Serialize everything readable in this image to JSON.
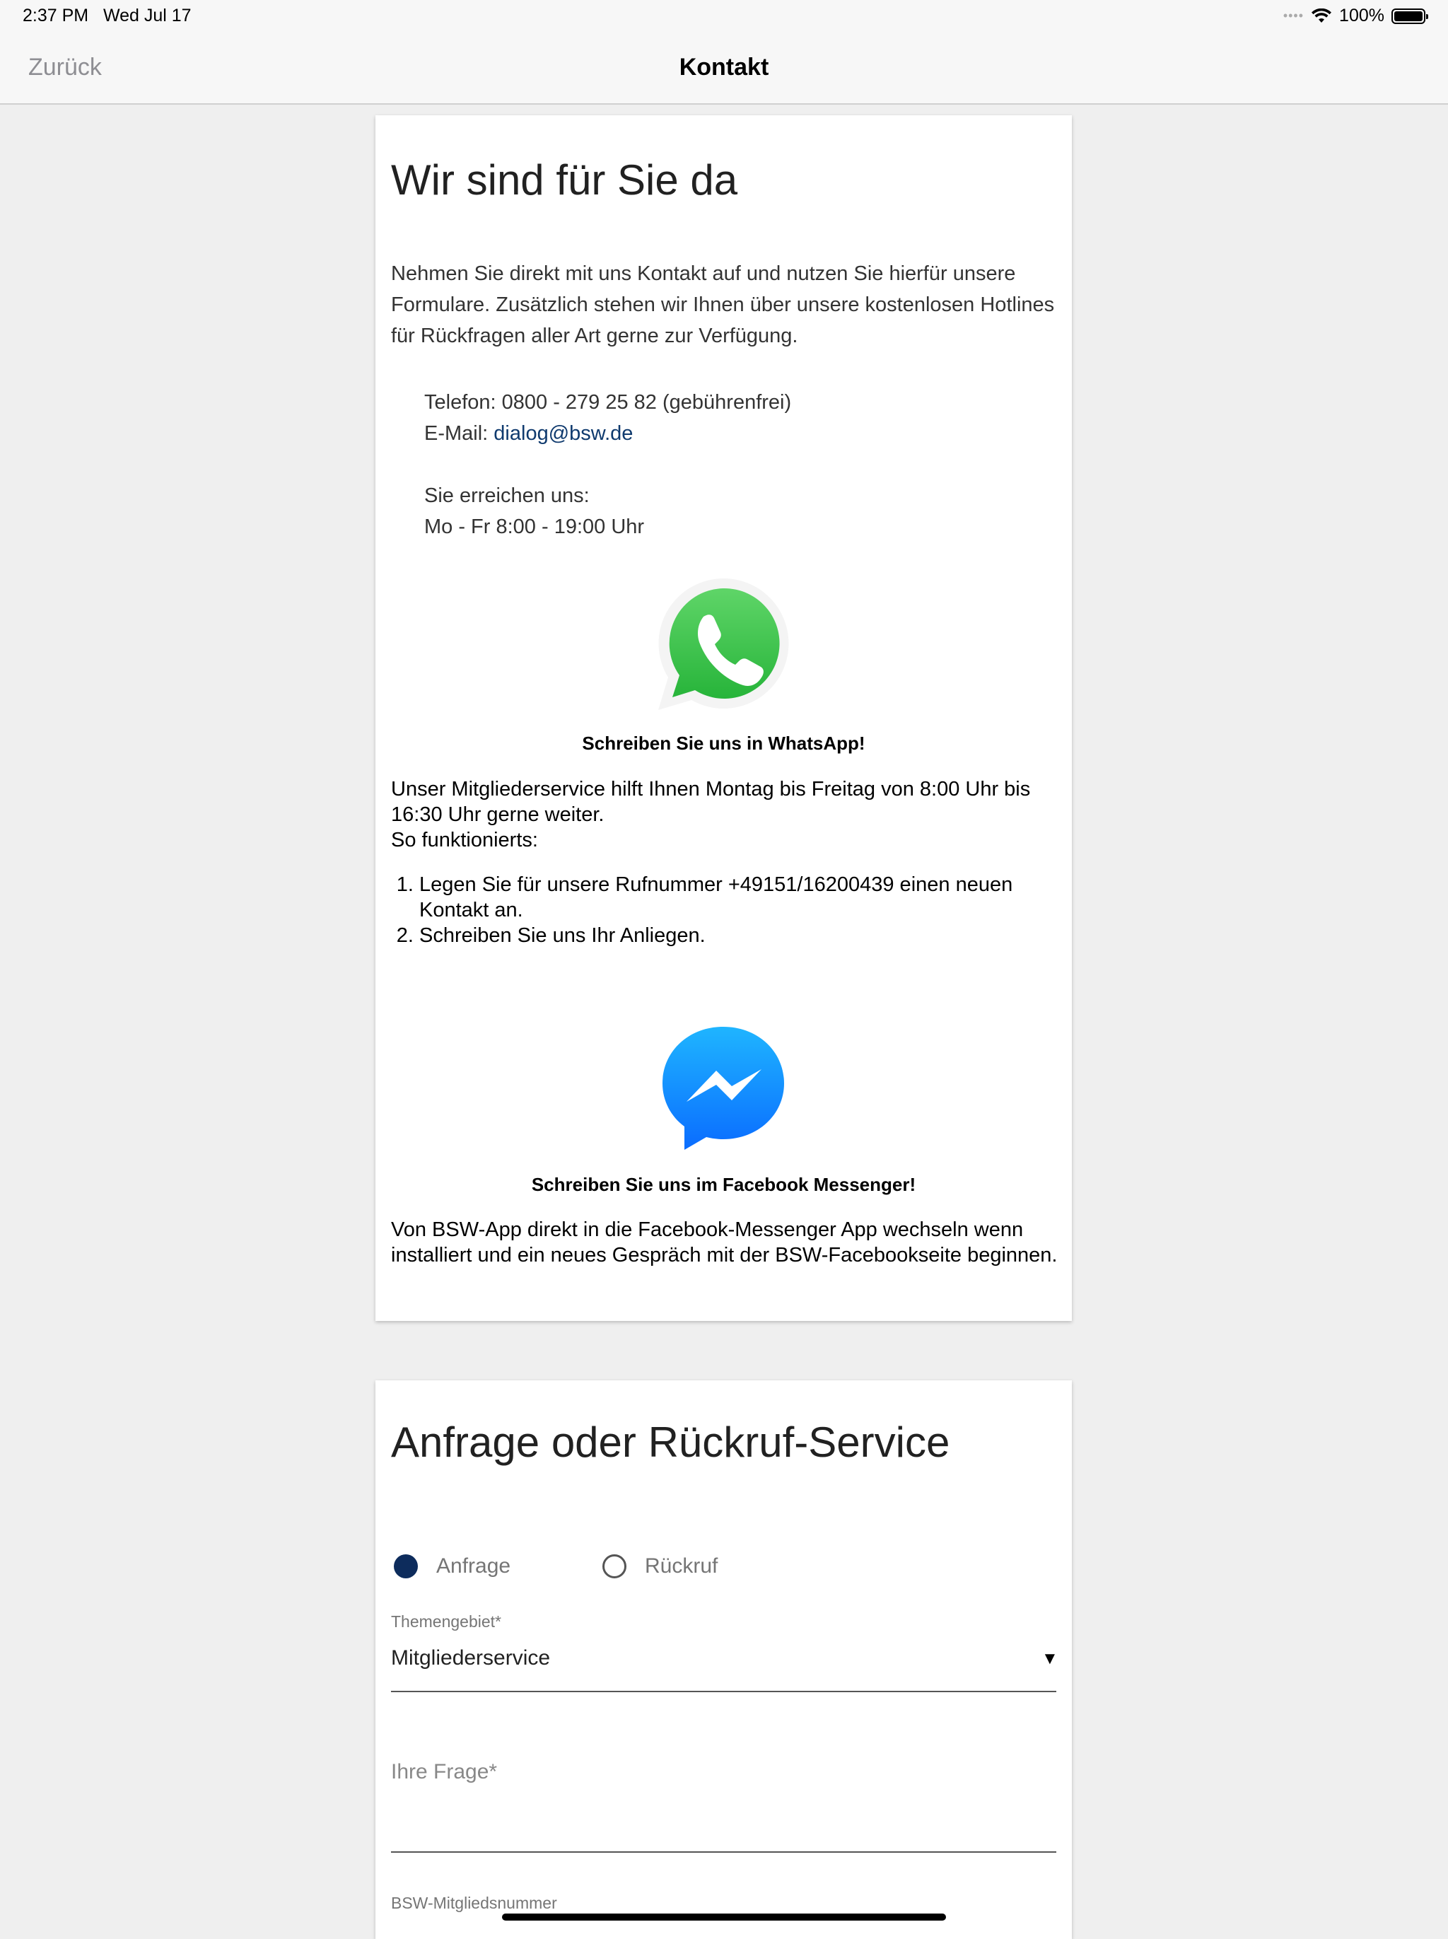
{
  "status_bar": {
    "time": "2:37 PM",
    "date": "Wed Jul 17",
    "signal_dots": "••••",
    "battery": "100%"
  },
  "nav": {
    "back_label": "Zurück",
    "title": "Kontakt"
  },
  "contact_card": {
    "heading": "Wir sind für Sie da",
    "intro": "Nehmen Sie direkt mit uns Kontakt auf und nutzen Sie hierfür unsere Formulare. Zusätzlich stehen wir Ihnen über unsere kostenlosen Hotlines für Rückfragen aller Art gerne zur Verfügung.",
    "phone": "Telefon: 0800 - 279 25 82 (gebührenfrei)",
    "email_label": "E-Mail: ",
    "email": "dialog@bsw.de",
    "hours_label": "Sie erreichen uns:",
    "hours": "Mo - Fr 8:00 - 19:00 Uhr",
    "whatsapp": {
      "title": "Schreiben Sie uns in WhatsApp!",
      "text": "Unser Mitgliederservice hilft Ihnen Montag bis Freitag von 8:00 Uhr bis 16:30 Uhr gerne weiter.",
      "how": "So funktionierts:",
      "steps": [
        "Legen Sie für unsere Rufnummer +49151/16200439 einen neuen Kontakt an.",
        "Schreiben Sie uns Ihr Anliegen."
      ]
    },
    "messenger": {
      "title": "Schreiben Sie uns im Facebook Messenger!",
      "text": "Von BSW-App direkt in die Facebook-Messenger App wechseln wenn installiert und ein neues Gespräch mit der BSW-Facebookseite beginnen."
    }
  },
  "request_card": {
    "heading": "Anfrage oder Rückruf-Service",
    "radio_options": [
      {
        "label": "Anfrage",
        "selected": true
      },
      {
        "label": "Rückruf",
        "selected": false
      }
    ],
    "topic_label": "Themengebiet*",
    "topic_value": "Mitgliederservice",
    "question_placeholder": "Ihre Frage*",
    "member_number_label": "BSW-Mitgliedsnummer"
  },
  "colors": {
    "selected_radio": "#0d2c5c",
    "link": "#0f3a6e",
    "whatsapp_green": "#2fbe3a",
    "messenger_blue": "#0a7cff"
  }
}
